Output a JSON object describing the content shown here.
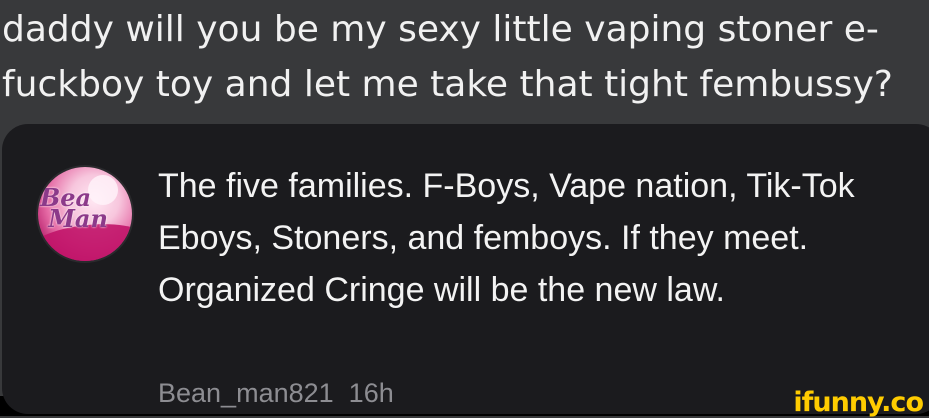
{
  "post": {
    "text": "daddy will you be my sexy little vaping stoner e-\nfuckboy toy and let me take that tight fembussy?"
  },
  "reply": {
    "avatar_logo": "Bean Man",
    "text": "The five families. F-Boys, Vape nation, Tik-Tok Eboys, Stoners, and femboys. If they meet. Organized Cringe will be the new law.",
    "author": "Bean_man821",
    "time": "16h"
  },
  "watermark": "ifunny.co"
}
